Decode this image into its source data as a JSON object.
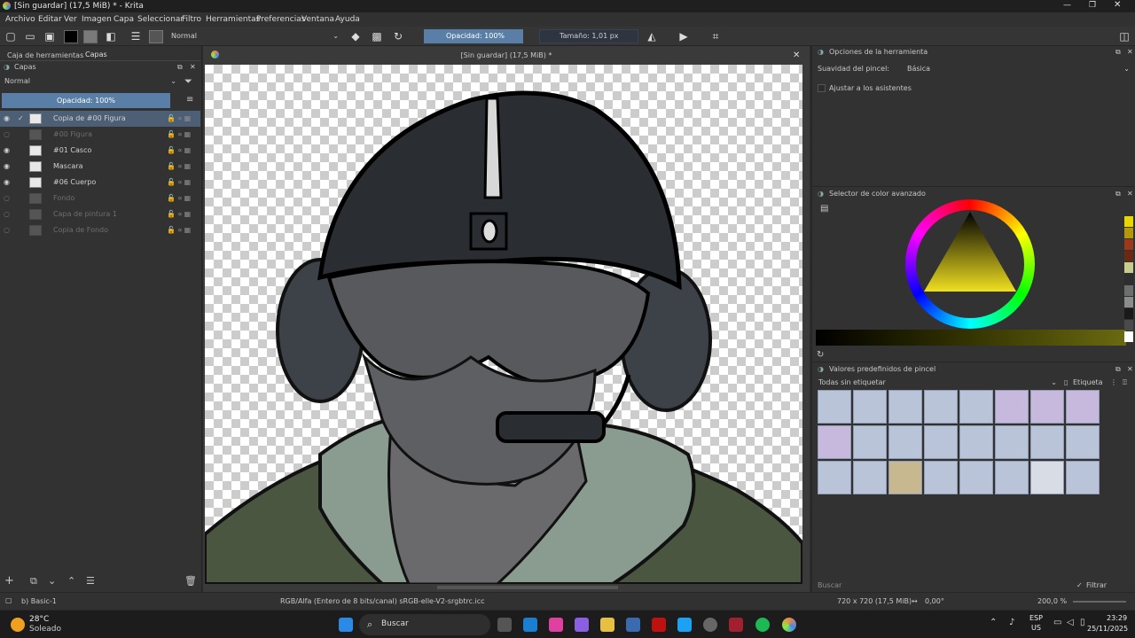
{
  "window": {
    "title": "[Sin guardar]  (17,5 MiB) * - Krita"
  },
  "menu": [
    "Archivo",
    "Editar",
    "Ver",
    "Imagen",
    "Capa",
    "Seleccionar",
    "Filtro",
    "Herramientas",
    "Preferencias",
    "Ventana",
    "Ayuda"
  ],
  "toolbar": {
    "blend_mode": "Normal",
    "opacity": "Opacidad: 100%",
    "size": "Tamaño: 1,01 px"
  },
  "left_dock": {
    "tabs": [
      "Caja de herramientas",
      "Capas"
    ],
    "panel_title": "Capas",
    "blend_mode": "Normal",
    "opacity": "Opacidad:  100%",
    "layers": [
      {
        "name": "Copia de #00 Figura",
        "visible": true,
        "selected": true
      },
      {
        "name": "#00 Figura",
        "visible": false,
        "selected": false
      },
      {
        "name": "#01 Casco",
        "visible": true,
        "selected": false
      },
      {
        "name": "Mascara",
        "visible": true,
        "selected": false
      },
      {
        "name": "#06 Cuerpo",
        "visible": true,
        "selected": false
      },
      {
        "name": "Fondo",
        "visible": false,
        "selected": false
      },
      {
        "name": "Capa de pintura 1",
        "visible": false,
        "selected": false
      },
      {
        "name": "Copia de Fondo",
        "visible": false,
        "selected": false
      }
    ]
  },
  "document": {
    "title": "[Sin guardar]  (17,5 MiB) *"
  },
  "right_dock": {
    "tool_options_title": "Opciones de la herramienta",
    "brush_smoothing_label": "Suavidad del pincel:",
    "brush_smoothing_value": "Básica",
    "snap_assistants": "Ajustar a los asistentes",
    "color_selector_title": "Selector de color avanzado",
    "presets_title": "Valores predefinidos de pincel",
    "presets_filter": "Todas sin etiquetar",
    "tag_label": "Etiqueta",
    "search_placeholder": "Buscar",
    "filter_tag": "Filtrar etiqueta",
    "swatch_colors": [
      "#e8d600",
      "#b8960a",
      "#9a3a1a",
      "#6a2a12",
      "#2e2e2e",
      "#c8cc8e",
      "#6e6e6e",
      "#8a8e8a",
      "#3a3a3a",
      "#1a1a1a",
      "#4a4a4a",
      "#ffffff"
    ]
  },
  "status": {
    "brush": "b) Basic-1",
    "color_info": "RGB/Alfa (Entero de 8 bits/canal)  sRGB-elle-V2-srgbtrc.icc",
    "image_size": "720 x 720 (17,5 MiB)",
    "rotation": "0,00°",
    "zoom": "200,0 %"
  },
  "taskbar": {
    "weather_temp": "28°C",
    "weather_desc": "Soleado",
    "search": "Buscar",
    "lang": "ESP",
    "lang2": "US",
    "time": "23:29",
    "date": "25/11/2025"
  }
}
